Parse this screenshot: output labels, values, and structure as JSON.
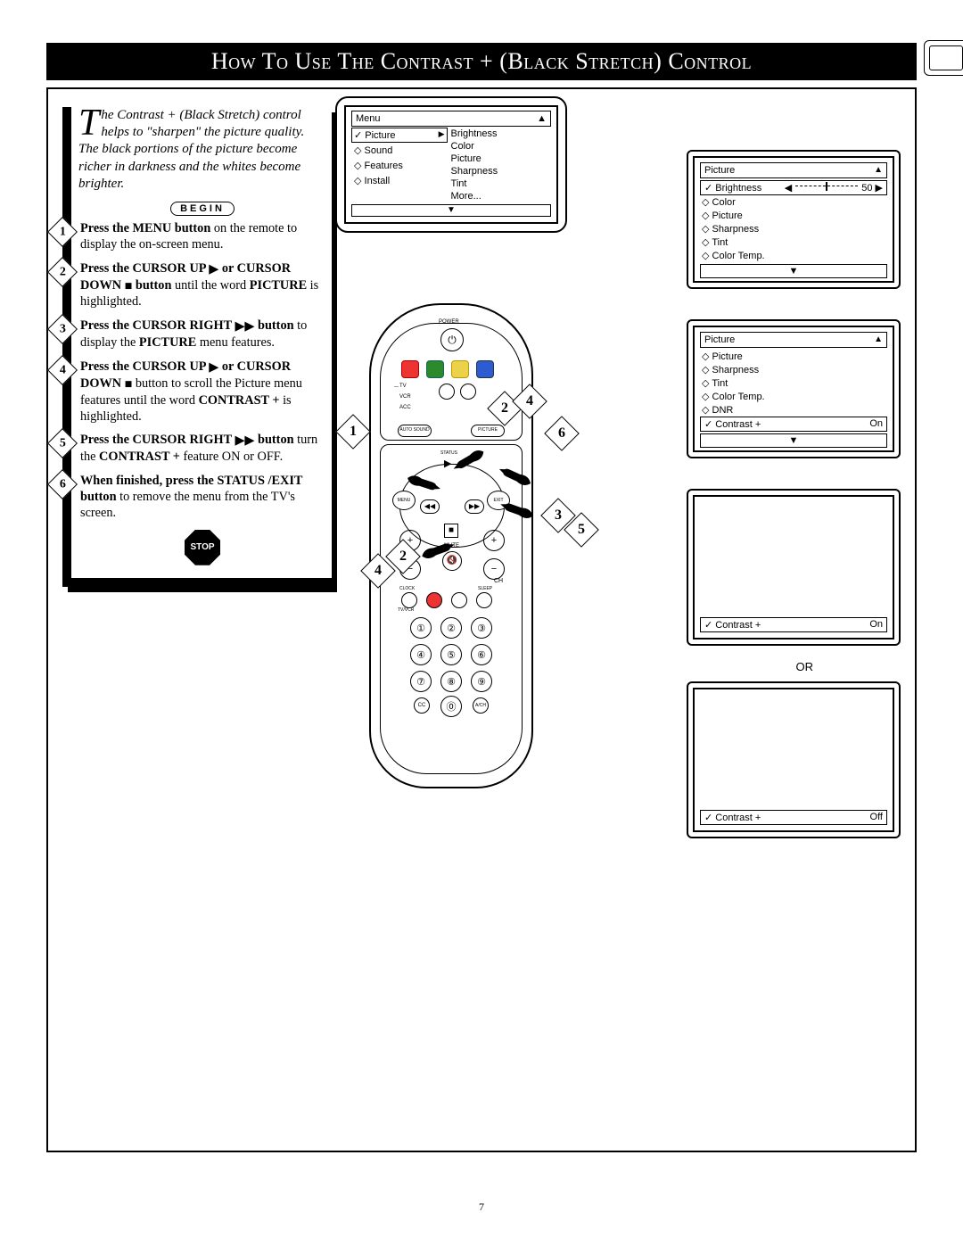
{
  "title": "How To Use The Contrast + (Black Stretch) Control",
  "intro": "The Contrast + (Black Stretch) control helps to \"sharpen\" the picture quality. The black portions of the picture become richer in darkness and the whites become brighter.",
  "begin_label": "BEGIN",
  "stop_label": "STOP",
  "page_number": "7",
  "or_label": "OR",
  "steps": {
    "s1a": "Press the MENU button",
    "s1b": " on the remote to display the on-screen menu.",
    "s2a": "Press the CURSOR UP ",
    "s2b": " or CURSOR DOWN ",
    "s2c": " button",
    "s2d": " until the word ",
    "s2e": "PICTURE",
    "s2f": " is highlighted.",
    "s3a": "Press the CURSOR RIGHT ",
    "s3b": " button",
    "s3c": " to display the ",
    "s3d": "PICTURE",
    "s3e": " menu features.",
    "s4a": "Press the CURSOR UP ",
    "s4b": " or CURSOR DOWN ",
    "s4c": " button to scroll the Picture menu features until the word ",
    "s4d": "CONTRAST +",
    "s4e": " is highlighted.",
    "s5a": "Press the CURSOR RIGHT ",
    "s5b": " button",
    "s5c": " turn the ",
    "s5d": "CONTRAST +",
    "s5e": " feature ON or OFF.",
    "s6a": "When finished, press the STATUS /EXIT button",
    "s6b": " to remove the menu from the TV's screen."
  },
  "osd": {
    "menu_label": "Menu",
    "col1": [
      "Picture",
      "Sound",
      "Features",
      "Install"
    ],
    "col2": [
      "Brightness",
      "Color",
      "Picture",
      "Sharpness",
      "Tint",
      "More..."
    ]
  },
  "mini1": {
    "hdr": "Picture",
    "row": {
      "label": "Brightness",
      "value": "50"
    },
    "items": [
      "Color",
      "Picture",
      "Sharpness",
      "Tint",
      "Color Temp."
    ]
  },
  "mini2": {
    "hdr": "Picture",
    "items": [
      "Picture",
      "Sharpness",
      "Tint",
      "Color Temp.",
      "DNR"
    ],
    "bot": {
      "label": "Contrast +",
      "value": "On"
    }
  },
  "mini3": {
    "label": "Contrast +",
    "value": "On"
  },
  "mini4": {
    "label": "Contrast +",
    "value": "Off"
  },
  "remote": {
    "power": "POWER",
    "tv": "TV",
    "vcr": "VCR",
    "acc": "ACC",
    "autosound": "AUTO SOUND",
    "picture": "PICTURE",
    "status": "STATUS",
    "menu": "MENU",
    "exit": "EXIT",
    "mute": "MUTE",
    "ch": "CH",
    "clock": "CLOCK",
    "sleep": "SLEEP",
    "tvvcr": "TV/VCR",
    "cc": "CC",
    "ach": "A/CH"
  }
}
